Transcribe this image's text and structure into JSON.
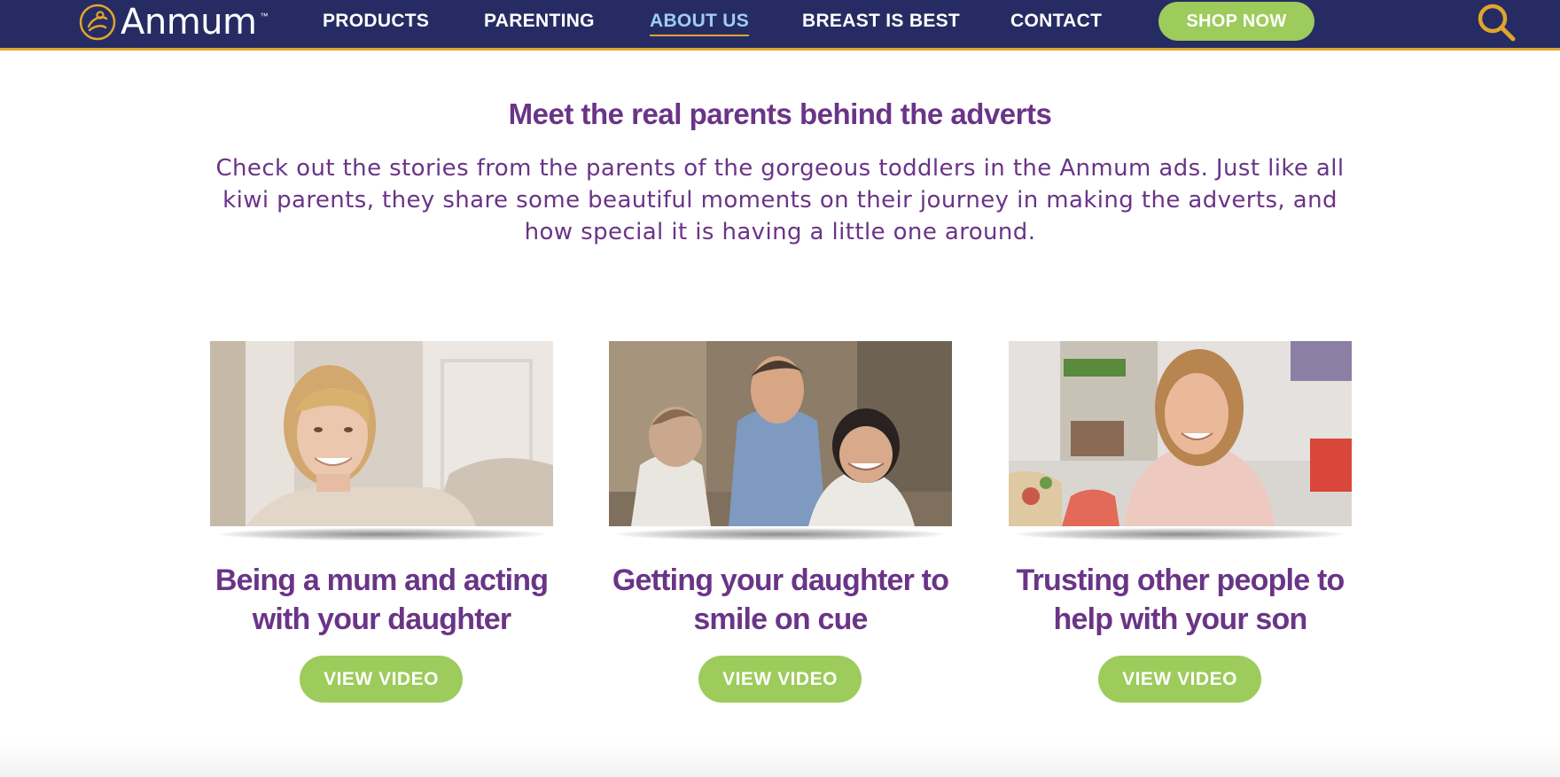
{
  "brand": {
    "name": "Anmum",
    "trademark": "™",
    "colors": {
      "navy": "#262c63",
      "gold": "#e0a52d",
      "purple": "#6a3487",
      "green": "#9dcb5c",
      "active_nav": "#9fcdf0"
    }
  },
  "nav": {
    "items": [
      {
        "label": "PRODUCTS",
        "active": false
      },
      {
        "label": "PARENTING",
        "active": false
      },
      {
        "label": "ABOUT US",
        "active": true
      },
      {
        "label": "BREAST IS BEST",
        "active": false
      },
      {
        "label": "CONTACT",
        "active": false
      }
    ],
    "shop_label": "SHOP NOW",
    "search_icon": "search-icon"
  },
  "intro": {
    "title": "Meet the real parents behind the adverts",
    "text": "Check out the stories from the parents of the gorgeous toddlers in the Anmum ads. Just like all kiwi parents, they share some beautiful moments on their journey in making the adverts, and how special it is having a little one around."
  },
  "cards": [
    {
      "title": "Being a mum and acting with your daughter",
      "button": "VIEW VIDEO",
      "thumbnail": "video-thumbnail"
    },
    {
      "title": "Getting your daughter to smile on cue",
      "button": "VIEW VIDEO",
      "thumbnail": "video-thumbnail"
    },
    {
      "title": "Trusting other people to help with your son",
      "button": "VIEW VIDEO",
      "thumbnail": "video-thumbnail"
    }
  ]
}
